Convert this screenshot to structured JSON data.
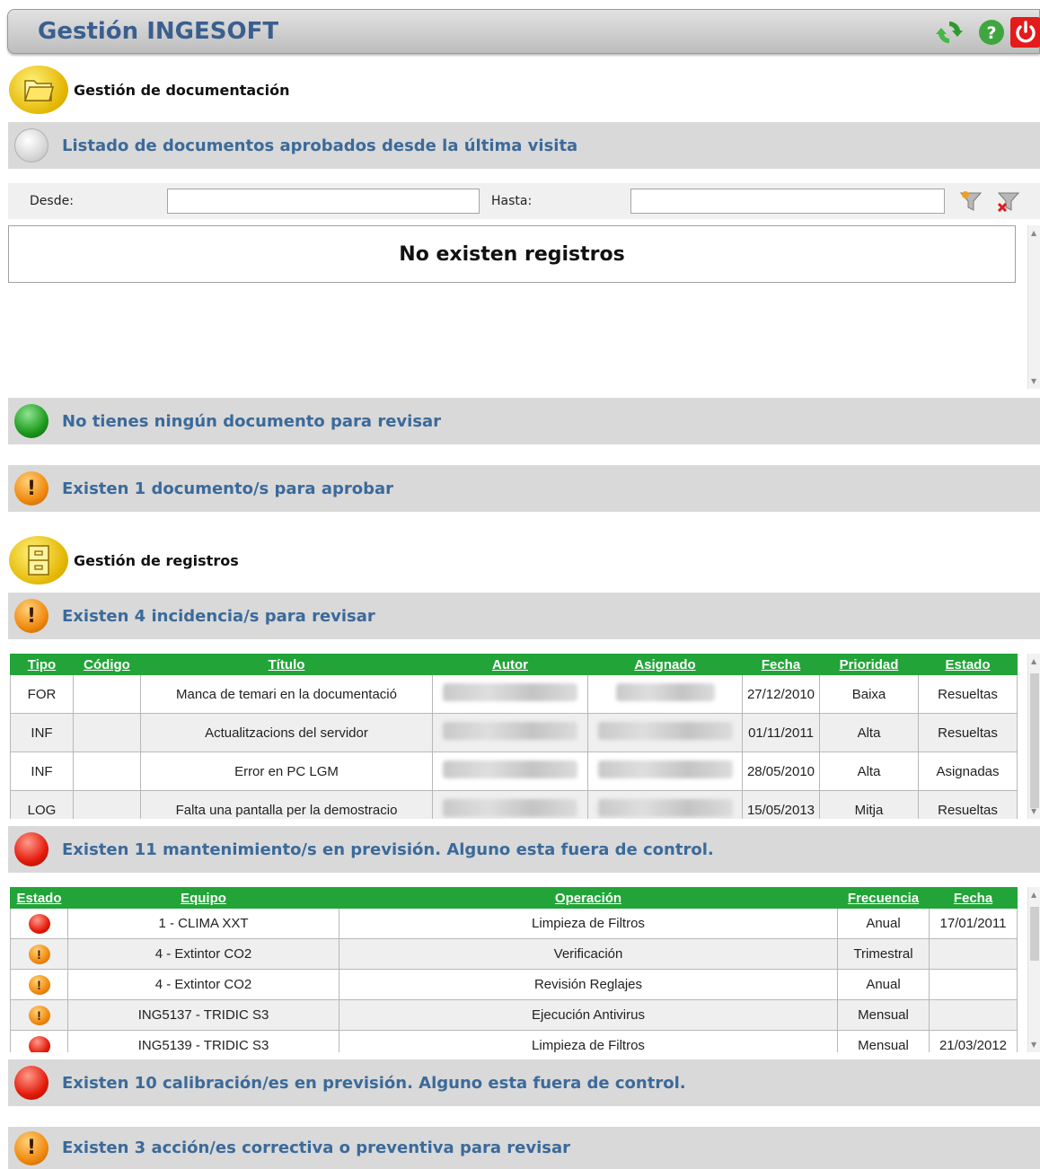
{
  "app": {
    "title": "Gestión INGESOFT"
  },
  "toolbar": {
    "refresh_icon": "refresh-icon",
    "help_icon": "help-icon",
    "power_icon": "power-icon"
  },
  "doc_section": {
    "title": "Gestión de documentación",
    "approved_title": "Listado de documentos aprobados desde la última visita",
    "filter": {
      "from_label": "Desde:",
      "to_label": "Hasta:",
      "from_value": "",
      "to_value": ""
    },
    "empty_message": "No existen registros",
    "review_title": "No tienes ningún documento para revisar",
    "approve_title": "Existen 1 documento/s para aprobar"
  },
  "reg_section": {
    "title": "Gestión de registros",
    "incidents_title": "Existen 4 incidencia/s para revisar",
    "incidents": {
      "headers": [
        "Tipo",
        "Código",
        "Título",
        "Autor",
        "Asignado",
        "Fecha",
        "Prioridad",
        "Estado"
      ],
      "rows": [
        {
          "tipo": "FOR",
          "codigo": "",
          "titulo": "Manca de temari en la documentació",
          "fecha": "27/12/2010",
          "prioridad": "Baixa",
          "estado": "Resueltas"
        },
        {
          "tipo": "INF",
          "codigo": "",
          "titulo": "Actualitzacions del servidor",
          "fecha": "01/11/2011",
          "prioridad": "Alta",
          "estado": "Resueltas"
        },
        {
          "tipo": "INF",
          "codigo": "",
          "titulo": "Error en PC LGM",
          "fecha": "28/05/2010",
          "prioridad": "Alta",
          "estado": "Asignadas"
        },
        {
          "tipo": "LOG",
          "codigo": "",
          "titulo": "Falta una pantalla per la demostracio",
          "fecha": "15/05/2013",
          "prioridad": "Mitja",
          "estado": "Resueltas"
        }
      ]
    },
    "maint_title": "Existen 11 mantenimiento/s en previsión. Alguno esta fuera de control.",
    "maint": {
      "headers": [
        "Estado",
        "Equipo",
        "Operación",
        "Frecuencia",
        "Fecha"
      ],
      "rows": [
        {
          "estado": "red",
          "equipo": "1 - CLIMA XXT",
          "operacion": "Limpieza de Filtros",
          "frecuencia": "Anual",
          "fecha": "17/01/2011"
        },
        {
          "estado": "orange",
          "equipo": "4 - Extintor CO2",
          "operacion": "Verificación",
          "frecuencia": "Trimestral",
          "fecha": ""
        },
        {
          "estado": "orange",
          "equipo": "4 - Extintor CO2",
          "operacion": "Revisión Reglajes",
          "frecuencia": "Anual",
          "fecha": ""
        },
        {
          "estado": "orange",
          "equipo": "ING5137 - TRIDIC S3",
          "operacion": "Ejecución Antivirus",
          "frecuencia": "Mensual",
          "fecha": ""
        },
        {
          "estado": "red",
          "equipo": "ING5139 - TRIDIC S3",
          "operacion": "Limpieza de Filtros",
          "frecuencia": "Mensual",
          "fecha": "21/03/2012"
        }
      ]
    },
    "calib_title": "Existen 10 calibración/es en previsión. Alguno esta fuera de control.",
    "actions_title": "Existen 3 acción/es correctiva o preventiva para revisar"
  },
  "colors": {
    "accent": "#3b6a9a",
    "header_green": "#22a438",
    "bar_gray": "#d9d9d9",
    "alert_red": "#e41b0b",
    "alert_orange": "#f08a10",
    "ok_green": "#1c9a1c"
  }
}
